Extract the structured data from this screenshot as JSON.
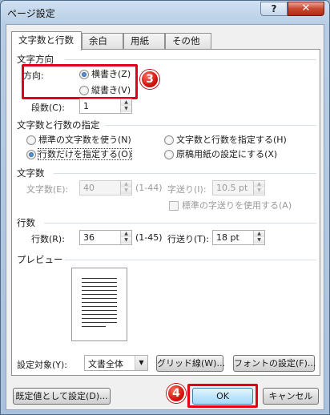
{
  "window": {
    "title": "ページ設定",
    "help": "?",
    "close": "✕"
  },
  "tabs": [
    "文字数と行数",
    "余白",
    "用紙",
    "その他"
  ],
  "text_direction": {
    "title": "文字方向",
    "label": "方向:",
    "options": [
      "横書き(Z)",
      "縦書き(V)"
    ],
    "selected": "横書き(Z)",
    "columns_label": "段数(C):",
    "columns_value": "1"
  },
  "grid": {
    "title": "文字数と行数の指定",
    "options": [
      "標準の文字数を使う(N)",
      "文字数と行数を指定する(H)",
      "行数だけを指定する(O)",
      "原稿用紙の設定にする(X)"
    ],
    "selected": "行数だけを指定する(O)"
  },
  "chars": {
    "title": "文字数",
    "count_label": "文字数(E):",
    "count_value": "40",
    "count_range": "(1-44)",
    "pitch_label": "字送り(I):",
    "pitch_value": "10.5 pt",
    "use_default_label": "標準の字送りを使用する(A)"
  },
  "lines": {
    "title": "行数",
    "count_label": "行数(R):",
    "count_value": "36",
    "count_range": "(1-45)",
    "pitch_label": "行送り(T):",
    "pitch_value": "18 pt"
  },
  "preview": {
    "title": "プレビュー"
  },
  "apply_to": {
    "label": "設定対象(Y):",
    "value": "文書全体"
  },
  "buttons": {
    "grid_lines": "グリッド線(W)...",
    "font_settings": "フォントの設定(F)...",
    "set_default": "既定値として設定(D)...",
    "ok": "OK",
    "cancel": "キャンセル"
  },
  "callouts": {
    "step3": "3",
    "step4": "4"
  },
  "colors": {
    "callout": "#e0001a",
    "title_bar": "#b8cde4",
    "close_button": "#c9462f"
  }
}
